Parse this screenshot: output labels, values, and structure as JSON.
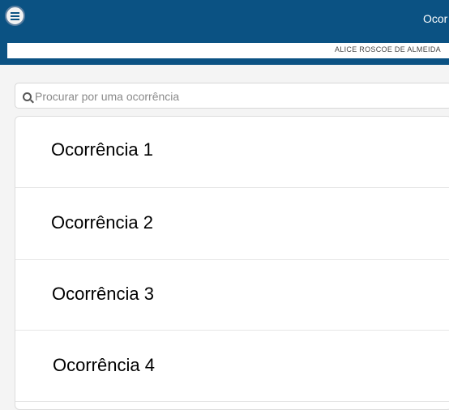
{
  "header": {
    "title": "Ocor",
    "menu_icon": "hamburger-menu-icon",
    "background_color": "#0b5283"
  },
  "user": {
    "name": "ALICE ROSCOE DE ALMEIDA"
  },
  "search": {
    "placeholder": "Procurar por uma ocorrência",
    "value": "",
    "icon": "search-icon"
  },
  "occurrences": [
    {
      "label": "Ocorrência 1"
    },
    {
      "label": "Ocorrência 2"
    },
    {
      "label": "Ocorrência 3"
    },
    {
      "label": "Ocorrência 4"
    }
  ]
}
